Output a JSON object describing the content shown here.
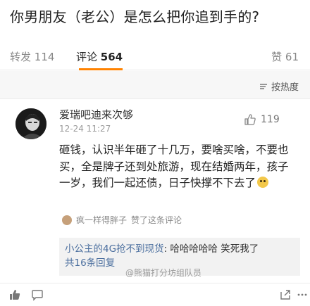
{
  "post": {
    "title": "你男朋友（老公）是怎么把你追到手的?"
  },
  "tabs": {
    "repost_label": "转发",
    "repost_count": "114",
    "comment_label": "评论",
    "comment_count": "564",
    "like_label": "赞",
    "like_count": "61"
  },
  "sort": {
    "label": "按热度"
  },
  "comment": {
    "username": "爱瑞吧迪来次够",
    "time": "12-24 11:27",
    "like_count": "119",
    "text": "砸钱，认识半年砸了十几万，要啥买啥，不要也买，全是牌子还到处旅游，现在结婚两年，孩子一岁，我们一起还债，日子快撑不下去了",
    "liked_by": "疯一样得胖子",
    "liked_suffix": "赞了这条评论"
  },
  "reply": {
    "user": "小公主的4G抢不到现货",
    "text": "哈哈哈哈哈 笑死我了",
    "total": "共16条回复"
  },
  "watermark": "@熊猫打分坊组队员"
}
